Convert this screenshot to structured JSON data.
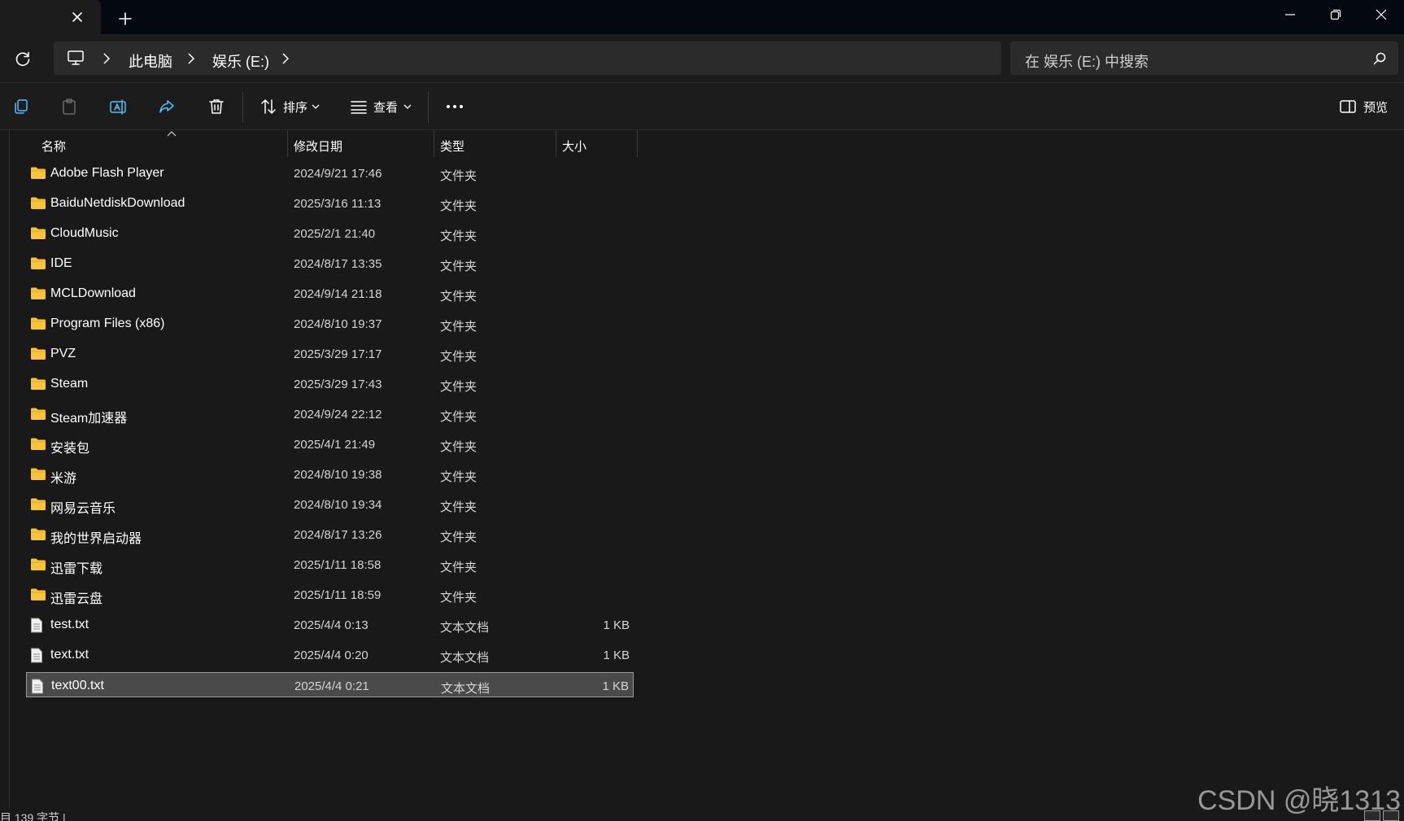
{
  "window": {
    "new_tab_symbol": "+",
    "accent": "#4cc2ff",
    "folder_color": "#f8c43c"
  },
  "address": {
    "crumbs": [
      "此电脑",
      "娱乐 (E:)"
    ]
  },
  "search": {
    "placeholder": "在 娱乐 (E:) 中搜索"
  },
  "toolbar": {
    "sort_label": "排序",
    "view_label": "查看",
    "preview_label": "预览",
    "icons": [
      "copy-icon",
      "paste-icon",
      "rename-icon",
      "share-icon",
      "delete-icon",
      "sort-icon",
      "view-icon",
      "more-icon",
      "preview-pane-icon"
    ]
  },
  "columns": {
    "name": "名称",
    "date": "修改日期",
    "type": "类型",
    "size": "大小"
  },
  "files": [
    {
      "name": "Adobe Flash Player",
      "date": "2024/9/21 17:46",
      "type": "文件夹",
      "size": "",
      "kind": "folder"
    },
    {
      "name": "BaiduNetdiskDownload",
      "date": "2025/3/16 11:13",
      "type": "文件夹",
      "size": "",
      "kind": "folder"
    },
    {
      "name": "CloudMusic",
      "date": "2025/2/1 21:40",
      "type": "文件夹",
      "size": "",
      "kind": "folder"
    },
    {
      "name": "IDE",
      "date": "2024/8/17 13:35",
      "type": "文件夹",
      "size": "",
      "kind": "folder"
    },
    {
      "name": "MCLDownload",
      "date": "2024/9/14 21:18",
      "type": "文件夹",
      "size": "",
      "kind": "folder"
    },
    {
      "name": "Program Files (x86)",
      "date": "2024/8/10 19:37",
      "type": "文件夹",
      "size": "",
      "kind": "folder"
    },
    {
      "name": "PVZ",
      "date": "2025/3/29 17:17",
      "type": "文件夹",
      "size": "",
      "kind": "folder"
    },
    {
      "name": "Steam",
      "date": "2025/3/29 17:43",
      "type": "文件夹",
      "size": "",
      "kind": "folder"
    },
    {
      "name": "Steam加速器",
      "date": "2024/9/24 22:12",
      "type": "文件夹",
      "size": "",
      "kind": "folder"
    },
    {
      "name": "安装包",
      "date": "2025/4/1 21:49",
      "type": "文件夹",
      "size": "",
      "kind": "folder"
    },
    {
      "name": "米游",
      "date": "2024/8/10 19:38",
      "type": "文件夹",
      "size": "",
      "kind": "folder"
    },
    {
      "name": "网易云音乐",
      "date": "2024/8/10 19:34",
      "type": "文件夹",
      "size": "",
      "kind": "folder"
    },
    {
      "name": "我的世界启动器",
      "date": "2024/8/17 13:26",
      "type": "文件夹",
      "size": "",
      "kind": "folder"
    },
    {
      "name": "迅雷下载",
      "date": "2025/1/11 18:58",
      "type": "文件夹",
      "size": "",
      "kind": "folder"
    },
    {
      "name": "迅雷云盘",
      "date": "2025/1/11 18:59",
      "type": "文件夹",
      "size": "",
      "kind": "folder"
    },
    {
      "name": "test.txt",
      "date": "2025/4/4 0:13",
      "type": "文本文档",
      "size": "1 KB",
      "kind": "file"
    },
    {
      "name": "text.txt",
      "date": "2025/4/4 0:20",
      "type": "文本文档",
      "size": "1 KB",
      "kind": "file"
    },
    {
      "name": "text00.txt",
      "date": "2025/4/4 0:21",
      "type": "文本文档",
      "size": "1 KB",
      "kind": "file",
      "selected": true
    }
  ],
  "status": {
    "text": "目 139 字节 |"
  },
  "watermark": "CSDN @晓1313"
}
